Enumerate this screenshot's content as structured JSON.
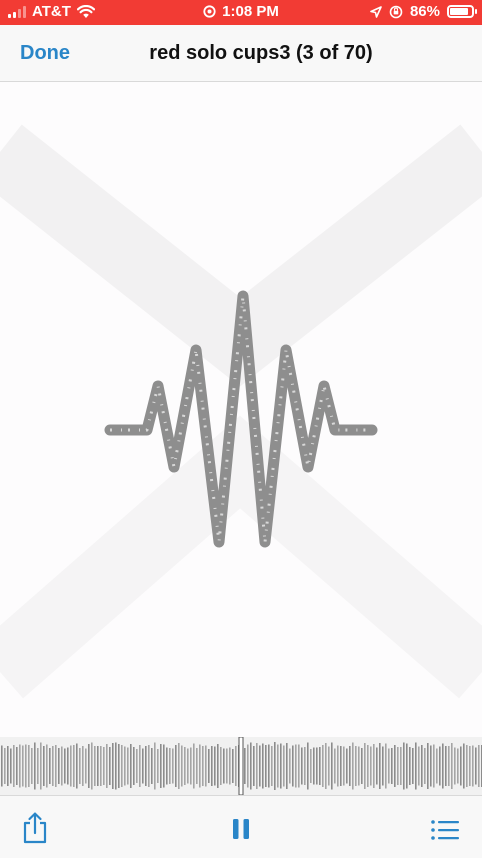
{
  "status_bar": {
    "carrier": "AT&T",
    "time": "1:08 PM",
    "battery_percent": "86%",
    "battery_level": 0.86,
    "icons": [
      "signal-icon",
      "wifi-icon",
      "alarm-icon",
      "location-icon",
      "orientation-lock-icon",
      "battery-icon"
    ]
  },
  "nav": {
    "done_label": "Done",
    "title": "red solo cups3 (3 of 70)"
  },
  "toolbar": {
    "icons": [
      "share-icon",
      "pause-icon",
      "list-icon"
    ]
  },
  "colors": {
    "status_bar": "#f23b34",
    "accent": "#2a86c8",
    "waveform": "#8e8e8e"
  }
}
